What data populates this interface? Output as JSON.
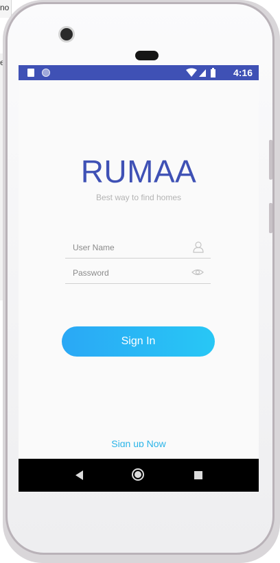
{
  "host": {
    "tab_text": "no",
    "side_text": "e"
  },
  "status_bar": {
    "time": "4:16",
    "color": "#3f51b5"
  },
  "app": {
    "title": "RUMAA",
    "tagline": "Best way to find homes",
    "brand_color": "#3f51b5",
    "accent_color": "#28c7f5"
  },
  "form": {
    "username_placeholder": "User Name",
    "password_placeholder": "Password",
    "username_icon": "user-icon",
    "password_icon": "eye-icon"
  },
  "actions": {
    "sign_in_label": "Sign In",
    "sign_up_label": "Sign up Now"
  },
  "nav": {
    "icons": [
      "back-icon",
      "home-icon",
      "recent-apps-icon"
    ]
  }
}
